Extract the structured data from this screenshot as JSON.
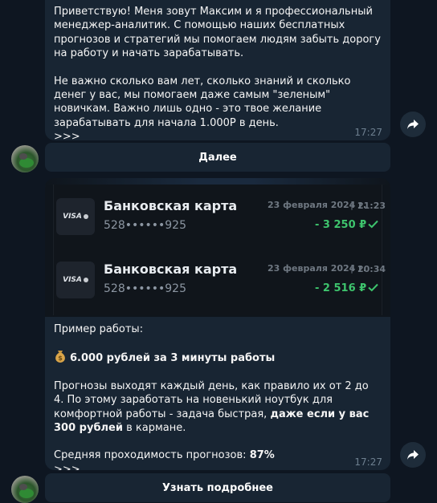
{
  "message1": {
    "paragraph1": "Приветствую! Меня зовут Максим и я профессиональный менеджер-аналитик. С помощью наших бесплатных прогнозов и стратегий мы помогаем людям забыть дорогу на работу и начать зарабатывать.",
    "paragraph2": "Не важно сколько вам лет, сколько знаний и сколько денег у вас, мы помогаем даже самым \"зеленым\" новичкам. Важно лишь одно - это твое желание зарабатывать для начала 1.000Р в день.",
    "more": ">>>",
    "time": "17:27",
    "button": "Далее"
  },
  "message2": {
    "media": {
      "cards": [
        {
          "brand": "VISA",
          "title": "Банковская карта",
          "number": "528••••••925",
          "date": "23 февраля 2024 г.",
          "time": "21:23",
          "amount": "- 3 250 ₽"
        },
        {
          "brand": "VISA",
          "title": "Банковская карта",
          "number": "528••••••925",
          "date": "23 февраля 2024 г.",
          "time": "20:34",
          "amount": "- 2 516 ₽"
        }
      ]
    },
    "intro": "Пример работы:",
    "highlight": "6.000 рублей за 3 минуты работы",
    "body_start": "Прогнозы выходят каждый день, как правило их от 2 до 4. По этому заработать на новенький ноутбук для комфортной работы - задача быстрая, ",
    "body_bold": "даже если у вас 300 рублей",
    "body_end": " в кармане.",
    "stats_label": "Средняя проходимость прогнозов: ",
    "stats_value": "87%",
    "more": ">>>",
    "time": "17:27",
    "button": "Узнать подробнее"
  },
  "colors": {
    "background": "#0e1621",
    "bubble": "#182533",
    "amount_green": "#3ec46d",
    "time_gray": "#6d7f8f"
  },
  "icons": [
    "share-icon",
    "avatar",
    "visa-logo",
    "check-icon",
    "money-bag-icon"
  ]
}
